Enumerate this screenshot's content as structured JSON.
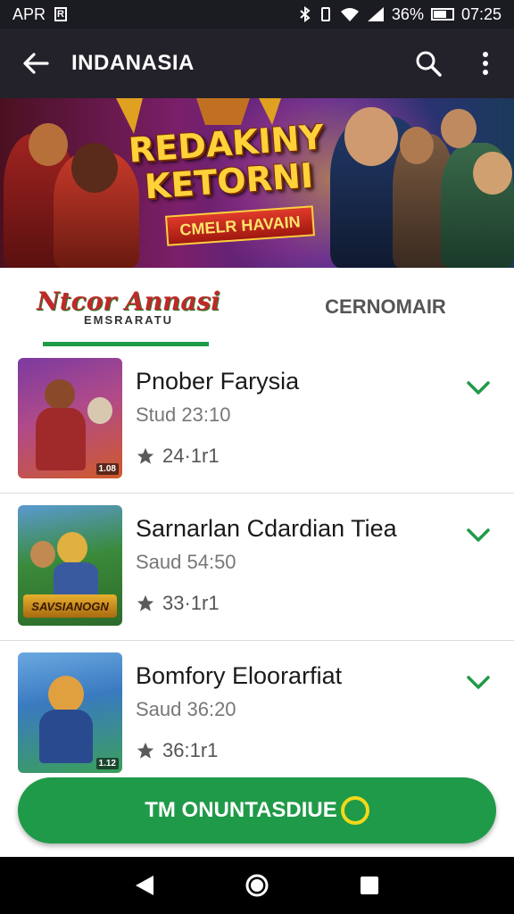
{
  "status": {
    "left_label": "APR",
    "left_icon": "R",
    "icons": [
      "bluetooth-icon",
      "vibrate-icon",
      "wifi-icon",
      "signal-icon"
    ],
    "battery": "36%",
    "time": "07:25"
  },
  "appbar": {
    "title": "INDANASIA",
    "back_icon": "arrow-left-icon",
    "search_icon": "search-icon",
    "menu_icon": "more-vert-icon"
  },
  "banner": {
    "headline": "REDAKINY KETORNI",
    "ribbon": "CMELR HAVAIN"
  },
  "tabs": [
    {
      "label": "Ntcor Annasi",
      "sublabel": "EMSRARATU",
      "active": true
    },
    {
      "label": "CERNOMAIR",
      "active": false
    }
  ],
  "items": [
    {
      "name": "Pnober Farysia",
      "time": "Stud 23:10",
      "rating": "24·1r1",
      "badge": "1.08",
      "colors": [
        "#7b3aa0",
        "#d05a2a"
      ]
    },
    {
      "name": "Sarnarlan Cdardian Tiea",
      "time": "Saud 54:50",
      "rating": "33·1r1",
      "badge": "",
      "colors": [
        "#2e8a3a",
        "#e0a030"
      ]
    },
    {
      "name": "Bomfory Eloorarfiat",
      "time": "Saud 36:20",
      "rating": "36:1r1",
      "badge": "1.12",
      "colors": [
        "#2a5aa8",
        "#3aa05a"
      ]
    }
  ],
  "cta": {
    "label": "TM ONUNTASDIUE"
  },
  "navbar": {
    "back": "back-triangle-icon",
    "home": "home-circle-icon",
    "recents": "recents-square-icon"
  },
  "colors": {
    "accent": "#1f9a48",
    "appbar": "#23222a",
    "statusbar": "#1b1b22"
  }
}
